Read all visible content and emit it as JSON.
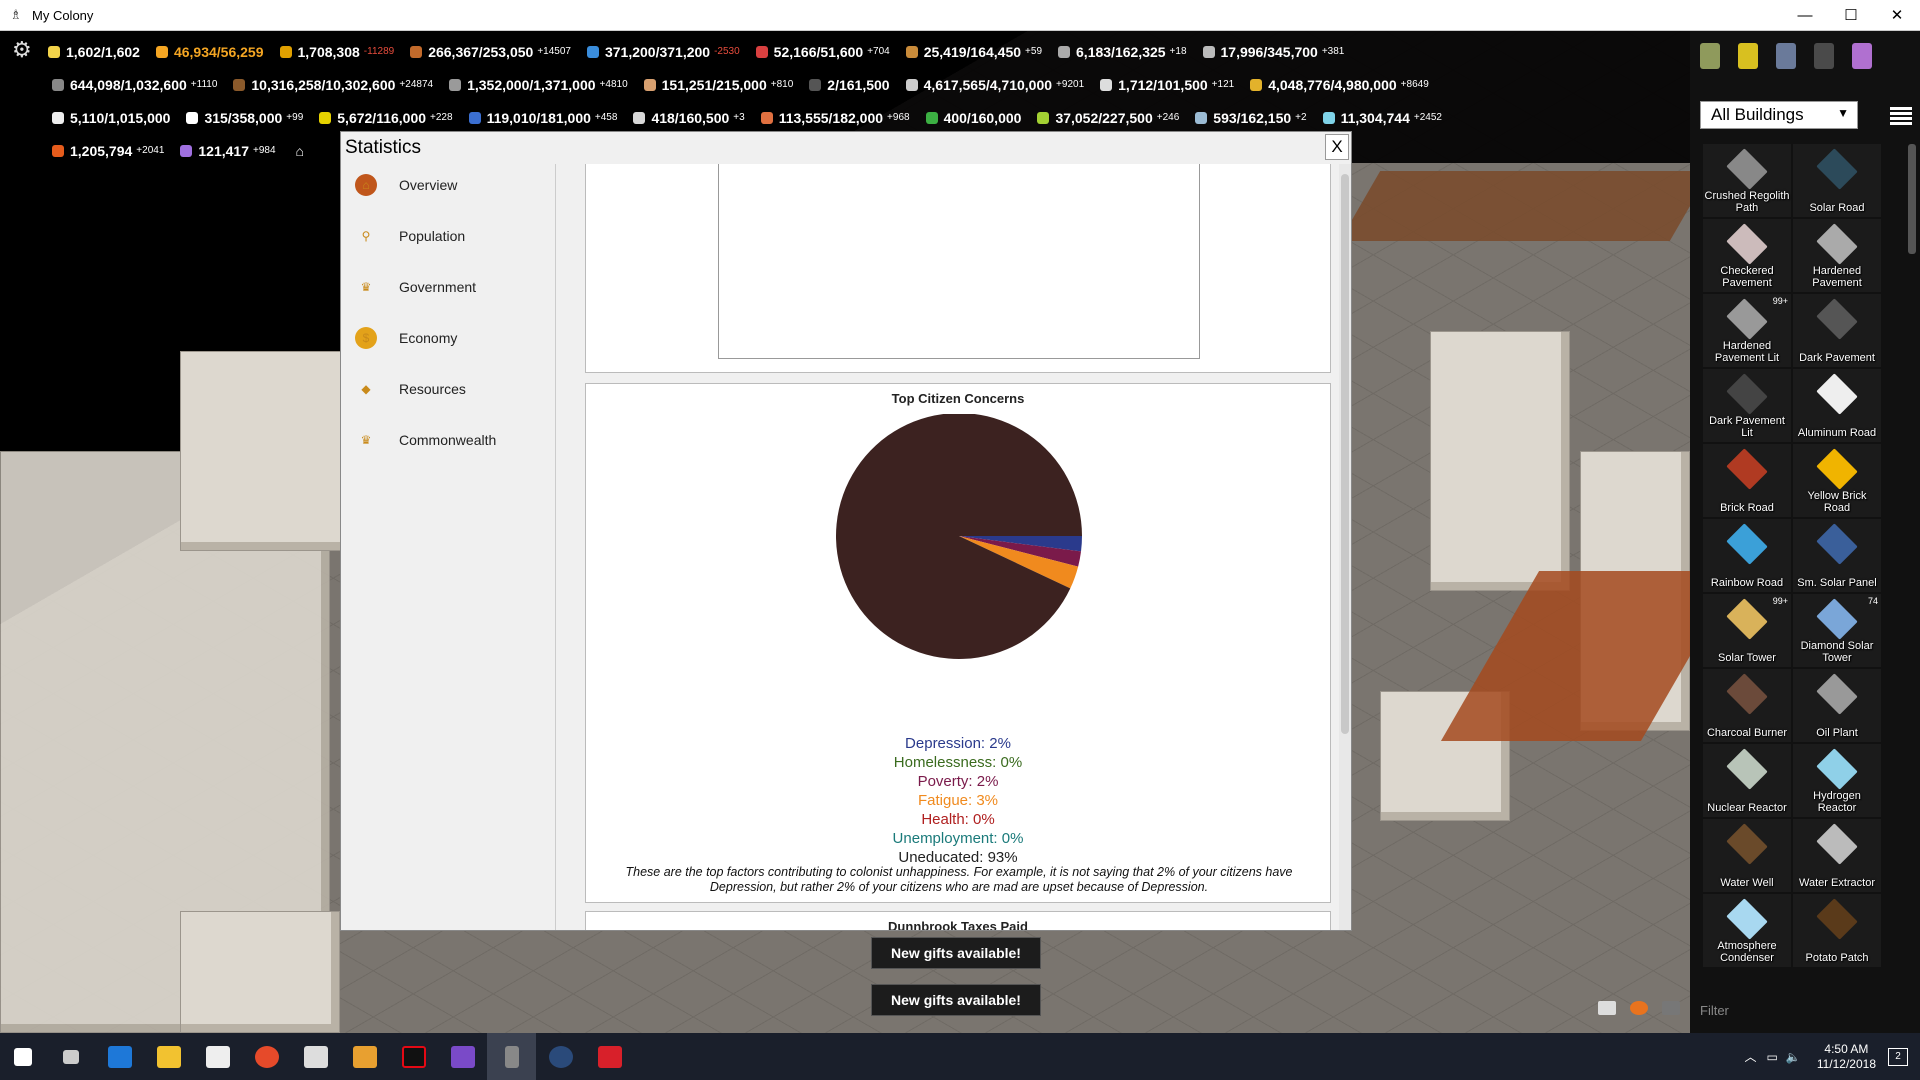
{
  "window": {
    "title": "My Colony",
    "minimize": "—",
    "maximize": "☐",
    "close": "✕"
  },
  "resources": {
    "row1": [
      {
        "icon": "lightbulb-icon",
        "color": "#f2d34a",
        "value": "1,602/1,602",
        "delta": ""
      },
      {
        "icon": "energy-icon",
        "color": "#f5a623",
        "value": "46,934/56,259",
        "delta": "",
        "value_color": "#f5a623"
      },
      {
        "icon": "coin-icon",
        "color": "#e0a000",
        "value": "1,708,308",
        "delta": "-11289",
        "delta_color": "#e74c3c"
      },
      {
        "icon": "wood-icon",
        "color": "#c26a2b",
        "value": "266,367/253,050",
        "delta": "+14507"
      },
      {
        "icon": "water-icon",
        "color": "#3a8ddc",
        "value": "371,200/371,200",
        "delta": "-2530",
        "delta_color": "#e74c3c"
      },
      {
        "icon": "food-icon",
        "color": "#d94040",
        "value": "52,166/51,600",
        "delta": "+704"
      },
      {
        "icon": "bread-icon",
        "color": "#c98b3a",
        "value": "25,419/164,450",
        "delta": "+59"
      },
      {
        "icon": "gear-resource-icon",
        "color": "#aaaaaa",
        "value": "6,183/162,325",
        "delta": "+18"
      },
      {
        "icon": "pipe-icon",
        "color": "#bbbbbb",
        "value": "17,996/345,700",
        "delta": "+381"
      }
    ],
    "row2": [
      {
        "icon": "rock-icon",
        "color": "#888888",
        "value": "644,098/1,032,600",
        "delta": "+1110"
      },
      {
        "icon": "ore-icon",
        "color": "#8b5a2b",
        "value": "10,316,258/10,302,600",
        "delta": "+24874"
      },
      {
        "icon": "stone-icon",
        "color": "#9a9a9a",
        "value": "1,352,000/1,371,000",
        "delta": "+4810"
      },
      {
        "icon": "clay-icon",
        "color": "#d8a070",
        "value": "151,251/215,000",
        "delta": "+810"
      },
      {
        "icon": "cable-icon",
        "color": "#555555",
        "value": "2/161,500",
        "delta": ""
      },
      {
        "icon": "steel-icon",
        "color": "#cccccc",
        "value": "4,617,565/4,710,000",
        "delta": "+9201"
      },
      {
        "icon": "cup-icon",
        "color": "#dddddd",
        "value": "1,712/101,500",
        "delta": "+121"
      },
      {
        "icon": "gold-icon",
        "color": "#e3b22b",
        "value": "4,048,776/4,980,000",
        "delta": "+8649"
      }
    ],
    "row3": [
      {
        "icon": "chalk-icon",
        "color": "#eeeeee",
        "value": "5,110/1,015,000",
        "delta": ""
      },
      {
        "icon": "diamond-icon",
        "color": "#ffffff",
        "value": "315/358,000",
        "delta": "+99"
      },
      {
        "icon": "uranium-icon",
        "color": "#e6d200",
        "value": "5,672/116,000",
        "delta": "+228"
      },
      {
        "icon": "book-icon",
        "color": "#3b6fd1",
        "value": "119,010/181,000",
        "delta": "+458"
      },
      {
        "icon": "silver-icon",
        "color": "#d8d8d8",
        "value": "418/160,500",
        "delta": "+3"
      },
      {
        "icon": "fish-icon",
        "color": "#e07040",
        "value": "113,555/182,000",
        "delta": "+968"
      },
      {
        "icon": "rainbow-icon",
        "color": "#3cb043",
        "value": "400/160,000",
        "delta": ""
      },
      {
        "icon": "gem-icon",
        "color": "#a3d133",
        "value": "37,052/227,500",
        "delta": "+246"
      },
      {
        "icon": "pearl-icon",
        "color": "#9bbbd4",
        "value": "593/162,150",
        "delta": "+2"
      },
      {
        "icon": "cloud-icon",
        "color": "#7fd3e8",
        "value": "11,304,744",
        "delta": "+2452"
      }
    ],
    "row4": [
      {
        "icon": "fire-icon",
        "color": "#e65c1c",
        "value": "1,205,794",
        "delta": "+2041"
      },
      {
        "icon": "potion-icon",
        "color": "#a070e0",
        "value": "121,417",
        "delta": "+984"
      }
    ]
  },
  "dialog": {
    "title": "Statistics",
    "close": "X",
    "nav": [
      {
        "name": "nav-overview",
        "icon": "home-icon",
        "icon_color": "#c0561b",
        "glyph": "⌂",
        "label": "Overview"
      },
      {
        "name": "nav-population",
        "icon": "person-icon",
        "icon_color": "#f0f0f0",
        "glyph": "⚲",
        "label": "Population"
      },
      {
        "name": "nav-government",
        "icon": "crown-icon",
        "icon_color": "#f0f0f0",
        "glyph": "♛",
        "label": "Government"
      },
      {
        "name": "nav-economy",
        "icon": "coin-icon",
        "icon_color": "#e3a21a",
        "glyph": "$",
        "label": "Economy"
      },
      {
        "name": "nav-resources",
        "icon": "resources-icon",
        "icon_color": "#f0f0f0",
        "glyph": "◆",
        "label": "Resources"
      },
      {
        "name": "nav-commonwealth",
        "icon": "crown-icon",
        "icon_color": "#f0f0f0",
        "glyph": "♛",
        "label": "Commonwealth"
      }
    ],
    "concerns_title": "Top Citizen Concerns",
    "legend": [
      {
        "label": "Depression: 2%",
        "color": "#2a3a8c"
      },
      {
        "label": "Homelessness: 0%",
        "color": "#3a6b1e"
      },
      {
        "label": "Poverty: 2%",
        "color": "#7a1a4a"
      },
      {
        "label": "Fatigue: 3%",
        "color": "#f08a1e"
      },
      {
        "label": "Health: 0%",
        "color": "#b02020"
      },
      {
        "label": "Unemployment: 0%",
        "color": "#1a7a7a"
      },
      {
        "label": "Uneducated: 93%",
        "color": "#222222"
      }
    ],
    "note": "These are the top factors contributing to colonist unhappiness. For example, it is not saying that 2% of your citizens have Depression, but rather 2% of your citizens who are mad are upset because of Depression.",
    "next_panel_title": "Dunnbrook Taxes Paid"
  },
  "chart_data": {
    "type": "pie",
    "title": "Top Citizen Concerns",
    "categories": [
      "Depression",
      "Homelessness",
      "Poverty",
      "Fatigue",
      "Health",
      "Unemployment",
      "Uneducated"
    ],
    "values": [
      2,
      0,
      2,
      3,
      0,
      0,
      93
    ],
    "colors": [
      "#2a3a8c",
      "#3a6b1e",
      "#7a1a4a",
      "#f08a1e",
      "#b02020",
      "#1a7a7a",
      "#3c2220"
    ]
  },
  "gifts": [
    "New gifts available!",
    "New gifts available!"
  ],
  "sidebar": {
    "filter_select": "All Buildings",
    "filter_placeholder": "Filter",
    "buildings": [
      {
        "label": "Crushed Regolith Path",
        "color": "#888",
        "badge": ""
      },
      {
        "label": "Solar Road",
        "color": "#2c4a5a",
        "badge": ""
      },
      {
        "label": "Checkered Pavement",
        "color": "#cbb",
        "badge": ""
      },
      {
        "label": "Hardened Pavement",
        "color": "#aaa",
        "badge": ""
      },
      {
        "label": "Hardened Pavement Lit",
        "color": "#999",
        "badge": "99+"
      },
      {
        "label": "Dark Pavement",
        "color": "#555",
        "badge": ""
      },
      {
        "label": "Dark Pavement Lit",
        "color": "#444",
        "badge": ""
      },
      {
        "label": "Aluminum Road",
        "color": "#eee",
        "badge": ""
      },
      {
        "label": "Brick Road",
        "color": "#b03a22",
        "badge": ""
      },
      {
        "label": "Yellow Brick Road",
        "color": "#f0b400",
        "badge": ""
      },
      {
        "label": "Rainbow Road",
        "color": "#3ba0d8",
        "badge": ""
      },
      {
        "label": "Sm. Solar Panel",
        "color": "#3a5f9a",
        "badge": ""
      },
      {
        "label": "Solar Tower",
        "color": "#d9b25a",
        "badge": "99+"
      },
      {
        "label": "Diamond Solar Tower",
        "color": "#7aa6d8",
        "badge": "74"
      },
      {
        "label": "Charcoal Burner",
        "color": "#6b4a3a",
        "badge": ""
      },
      {
        "label": "Oil Plant",
        "color": "#999",
        "badge": ""
      },
      {
        "label": "Nuclear Reactor",
        "color": "#b8c4b8",
        "badge": ""
      },
      {
        "label": "Hydrogen Reactor",
        "color": "#8fd0e8",
        "badge": ""
      },
      {
        "label": "Water Well",
        "color": "#6a4a2a",
        "badge": ""
      },
      {
        "label": "Water Extractor",
        "color": "#bbb",
        "badge": ""
      },
      {
        "label": "Atmosphere Condenser",
        "color": "#a8d8f0",
        "badge": ""
      },
      {
        "label": "Potato Patch",
        "color": "#5a3a1a",
        "badge": ""
      }
    ]
  },
  "taskbar": {
    "time": "4:50 AM",
    "date": "11/12/2018",
    "notifications": "2"
  }
}
